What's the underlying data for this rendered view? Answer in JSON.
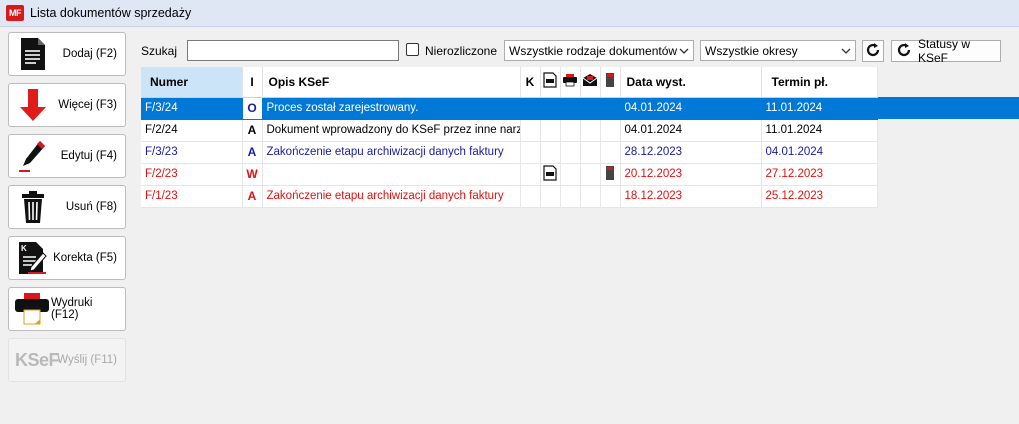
{
  "window": {
    "title": "Lista dokumentów sprzedaży",
    "logo": "MF"
  },
  "sidebar": {
    "buttons": [
      {
        "label": "Dodaj (F2)",
        "icon": "document-add-icon"
      },
      {
        "label": "Więcej (F3)",
        "icon": "arrow-down-icon"
      },
      {
        "label": "Edytuj (F4)",
        "icon": "pen-icon"
      },
      {
        "label": "Usuń (F8)",
        "icon": "trash-icon"
      },
      {
        "label": "Korekta (F5)",
        "icon": "correction-icon"
      },
      {
        "label": "Wydruki (F12)",
        "icon": "printer-icon"
      },
      {
        "label": "Wyślij (F11)",
        "icon": "ksef-icon",
        "logo_text": "KSeF",
        "disabled": true
      }
    ]
  },
  "filters": {
    "search_label": "Szukaj",
    "search_value": "",
    "unsettled_label": "Nierozliczone",
    "unsettled_checked": false,
    "doc_types_selected": "Wszystkie rodzaje dokumentów",
    "periods_selected": "Wszystkie okresy",
    "refresh_icon": "refresh-icon",
    "ksef_status_label": "Statusy w KSeF"
  },
  "table": {
    "columns": {
      "number": "Numer",
      "i": "I",
      "ksef_desc": "Opis KSeF",
      "k": "K",
      "issue_date": "Data wyst.",
      "due_date": "Termin pł."
    },
    "column_icons": [
      "document-icon",
      "printer-icon",
      "email-icon",
      "fiscal-printer-icon"
    ],
    "rows": [
      {
        "number": "F/3/24",
        "i": "O",
        "ksef_desc": "Proces został zarejestrowany.",
        "issue_date": "04.01.2024",
        "due_date": "11.01.2024",
        "state": "selected"
      },
      {
        "number": "F/2/24",
        "i": "A",
        "ksef_desc": "Dokument wprowadzony do KSeF przez inne narzę...",
        "issue_date": "04.01.2024",
        "due_date": "11.01.2024",
        "state": "normal"
      },
      {
        "number": "F/3/23",
        "i": "A",
        "ksef_desc": "Zakończenie etapu archiwizacji danych faktury",
        "issue_date": "28.12.2023",
        "due_date": "04.01.2024",
        "state": "blue"
      },
      {
        "number": "F/2/23",
        "i": "W",
        "ksef_desc": "",
        "issue_date": "20.12.2023",
        "due_date": "27.12.2023",
        "state": "red",
        "has_doc_icon": true,
        "has_fiscal_icon": true
      },
      {
        "number": "F/1/23",
        "i": "A",
        "ksef_desc": "Zakończenie etapu archiwizacji danych faktury",
        "issue_date": "18.12.2023",
        "due_date": "25.12.2023",
        "state": "red"
      }
    ]
  },
  "colors": {
    "selected_row": "#0078d7",
    "overdue": "#e01010",
    "paid": "#1a1aa6",
    "header_selected": "#cce4f7"
  }
}
